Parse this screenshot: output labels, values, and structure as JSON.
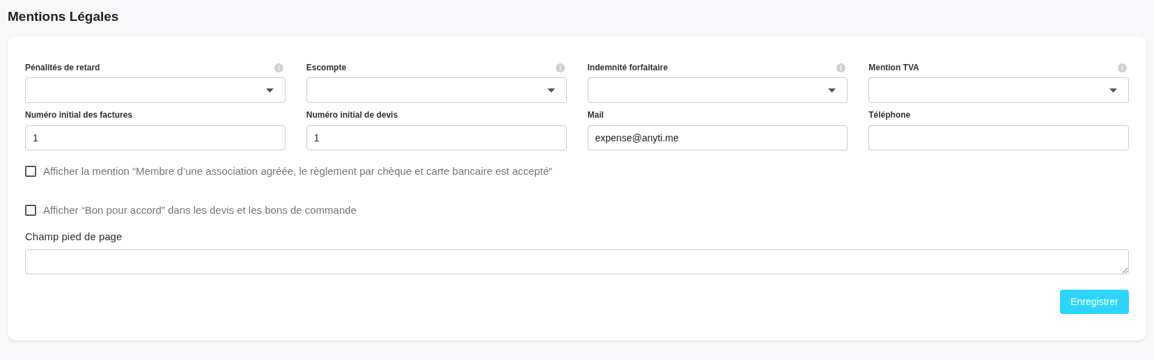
{
  "title": "Mentions Légales",
  "selects": [
    {
      "label": "Pénalités de retard"
    },
    {
      "label": "Escompte"
    },
    {
      "label": "Indemnité forfaitaire"
    },
    {
      "label": "Mention TVA"
    }
  ],
  "inputs": [
    {
      "label": "Numéro initial des factures",
      "value": "1"
    },
    {
      "label": "Numéro initial de devis",
      "value": "1"
    },
    {
      "label": "Mail",
      "value": "expense@anyti.me"
    },
    {
      "label": "Téléphone"
    }
  ],
  "checkboxes": [
    {
      "label": "Afficher la mention “Membre d’une association agréée, le règlement par chèque et carte bancaire est accepté”",
      "checked": false
    },
    {
      "label": "Afficher “Bon pour accord” dans les devis et les bons de commande",
      "checked": false
    }
  ],
  "footer_field": {
    "label": "Champ pied de page"
  },
  "save_button": "Enregistrer"
}
